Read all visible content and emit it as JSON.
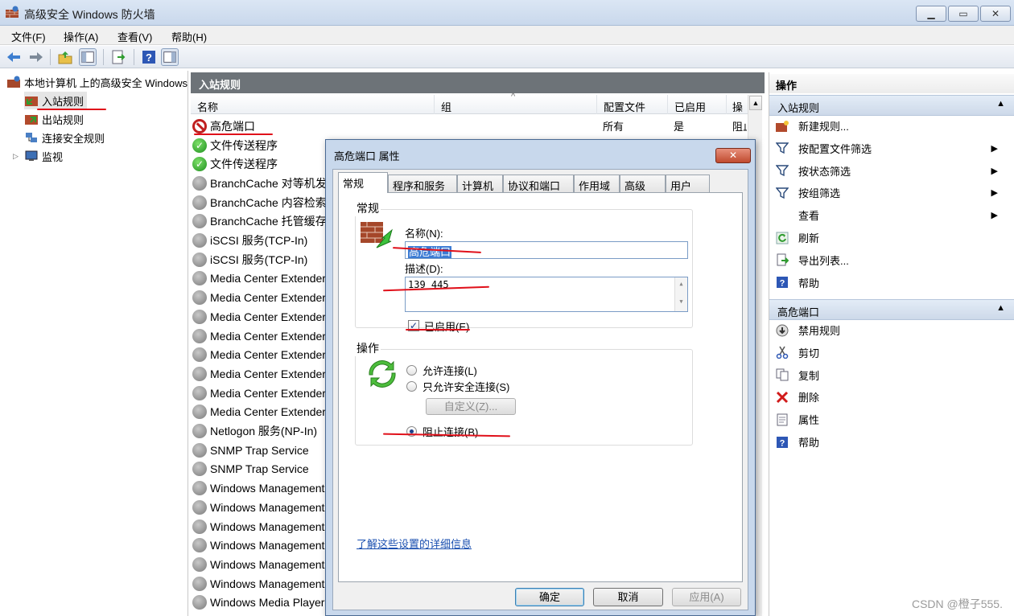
{
  "window": {
    "title": "高级安全 Windows 防火墙",
    "minimize": "▁",
    "maximize": "▭",
    "close": "✕"
  },
  "menu": [
    "文件(F)",
    "操作(A)",
    "查看(V)",
    "帮助(H)"
  ],
  "tree": {
    "root": "本地计算机 上的高级安全 Windows 防火墙",
    "items": [
      "入站规则",
      "出站规则",
      "连接安全规则",
      "监视"
    ]
  },
  "center": {
    "header": "入站规则",
    "columns": [
      "名称",
      "组",
      "配置文件",
      "已启用",
      "操作"
    ],
    "sort_indicator": "^",
    "rows": [
      {
        "name": "高危端口",
        "profile": "所有",
        "enabled": "是",
        "action": "阻止",
        "icon": "block"
      },
      {
        "name": "文件传送程序",
        "icon": "allow"
      },
      {
        "name": "文件传送程序",
        "icon": "allow"
      },
      {
        "name": "BranchCache 对等机发现",
        "icon": "disabled"
      },
      {
        "name": "BranchCache 内容检索",
        "icon": "disabled"
      },
      {
        "name": "BranchCache 托管缓存",
        "icon": "disabled"
      },
      {
        "name": "iSCSI 服务(TCP-In)",
        "icon": "disabled"
      },
      {
        "name": "iSCSI 服务(TCP-In)",
        "icon": "disabled"
      },
      {
        "name": "Media Center Extenders",
        "icon": "disabled"
      },
      {
        "name": "Media Center Extenders",
        "icon": "disabled"
      },
      {
        "name": "Media Center Extenders",
        "icon": "disabled"
      },
      {
        "name": "Media Center Extenders",
        "icon": "disabled"
      },
      {
        "name": "Media Center Extenders",
        "icon": "disabled"
      },
      {
        "name": "Media Center Extenders",
        "icon": "disabled"
      },
      {
        "name": "Media Center Extenders",
        "icon": "disabled"
      },
      {
        "name": "Media Center Extenders",
        "icon": "disabled"
      },
      {
        "name": "Netlogon 服务(NP-In)",
        "icon": "disabled"
      },
      {
        "name": "SNMP Trap Service",
        "icon": "disabled"
      },
      {
        "name": "SNMP Trap Service",
        "icon": "disabled"
      },
      {
        "name": "Windows Management",
        "icon": "disabled"
      },
      {
        "name": "Windows Management",
        "icon": "disabled"
      },
      {
        "name": "Windows Management",
        "icon": "disabled"
      },
      {
        "name": "Windows Management",
        "icon": "disabled"
      },
      {
        "name": "Windows Management",
        "icon": "disabled"
      },
      {
        "name": "Windows Management",
        "icon": "disabled"
      },
      {
        "name": "Windows Media Player",
        "icon": "disabled"
      }
    ]
  },
  "actions": {
    "header": "操作",
    "section1": {
      "title": "入站规则",
      "items": [
        "新建规则...",
        "按配置文件筛选",
        "按状态筛选",
        "按组筛选",
        "查看",
        "刷新",
        "导出列表...",
        "帮助"
      ]
    },
    "section2": {
      "title": "高危端口",
      "items": [
        "禁用规则",
        "剪切",
        "复制",
        "删除",
        "属性",
        "帮助"
      ]
    }
  },
  "dialog": {
    "title": "高危端口 属性",
    "close": "✕",
    "tabs": [
      "常规",
      "程序和服务",
      "计算机",
      "协议和端口",
      "作用域",
      "高级",
      "用户"
    ],
    "general_group": "常规",
    "name_label": "名称(N):",
    "name_value": "高危端口",
    "desc_label": "描述(D):",
    "desc_value": "139 445",
    "enabled_label": "已启用(E)",
    "enabled_check": "✓",
    "action_group": "操作",
    "radio_allow": "允许连接(L)",
    "radio_secure": "只允许安全连接(S)",
    "customize": "自定义(Z)...",
    "radio_block": "阻止连接(B)",
    "learn_more": "了解这些设置的详细信息",
    "ok": "确定",
    "cancel": "取消",
    "apply": "应用(A)"
  },
  "watermark": "CSDN @橙子555."
}
